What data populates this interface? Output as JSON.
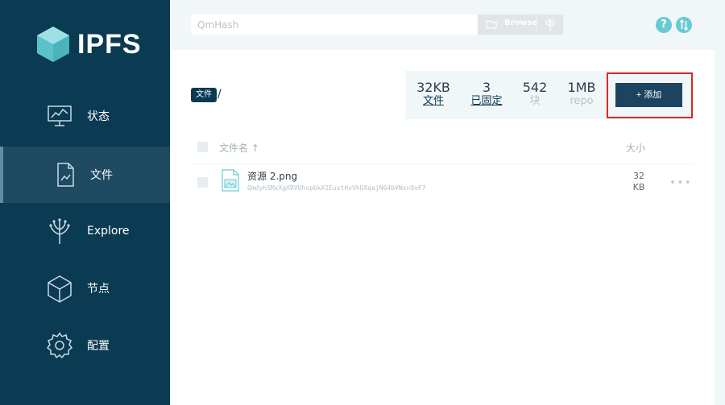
{
  "app": {
    "logo_text": "IPFS"
  },
  "nav": {
    "items": [
      {
        "label": "状态",
        "icon": "status-monitor-icon"
      },
      {
        "label": "文件",
        "icon": "files-icon",
        "active": true
      },
      {
        "label": "Explore",
        "icon": "explore-tree-icon"
      },
      {
        "label": "节点",
        "icon": "peers-cube-icon"
      },
      {
        "label": "配置",
        "icon": "settings-gear-icon"
      }
    ]
  },
  "topbar": {
    "hash_placeholder": "QmHash",
    "browse_label": "Browse"
  },
  "breadcrumb": {
    "root": "文件",
    "separator": "/"
  },
  "stats": [
    {
      "value": "32KB",
      "label": "文件"
    },
    {
      "value": "3",
      "label": "已固定"
    },
    {
      "value": "542",
      "label": "块"
    },
    {
      "value": "1MB",
      "label": "repo"
    }
  ],
  "add_button": {
    "label": "+ 添加"
  },
  "table": {
    "header": {
      "name": "文件名 ↑",
      "size": "大小"
    },
    "rows": [
      {
        "name": "资源 2.png",
        "hash": "QmdyhSMxXgXRVUhvpbkX1EuxtHvVhUXqajN64bVNsn9oF7",
        "size_value": "32",
        "size_unit": "KB",
        "more": "•••"
      }
    ]
  },
  "colors": {
    "sidebar_bg": "#0b3a53",
    "sidebar_active": "#1e4a62",
    "accent_teal": "#6acad1",
    "highlight_red": "#e02424",
    "button_bg": "#1c4461"
  }
}
